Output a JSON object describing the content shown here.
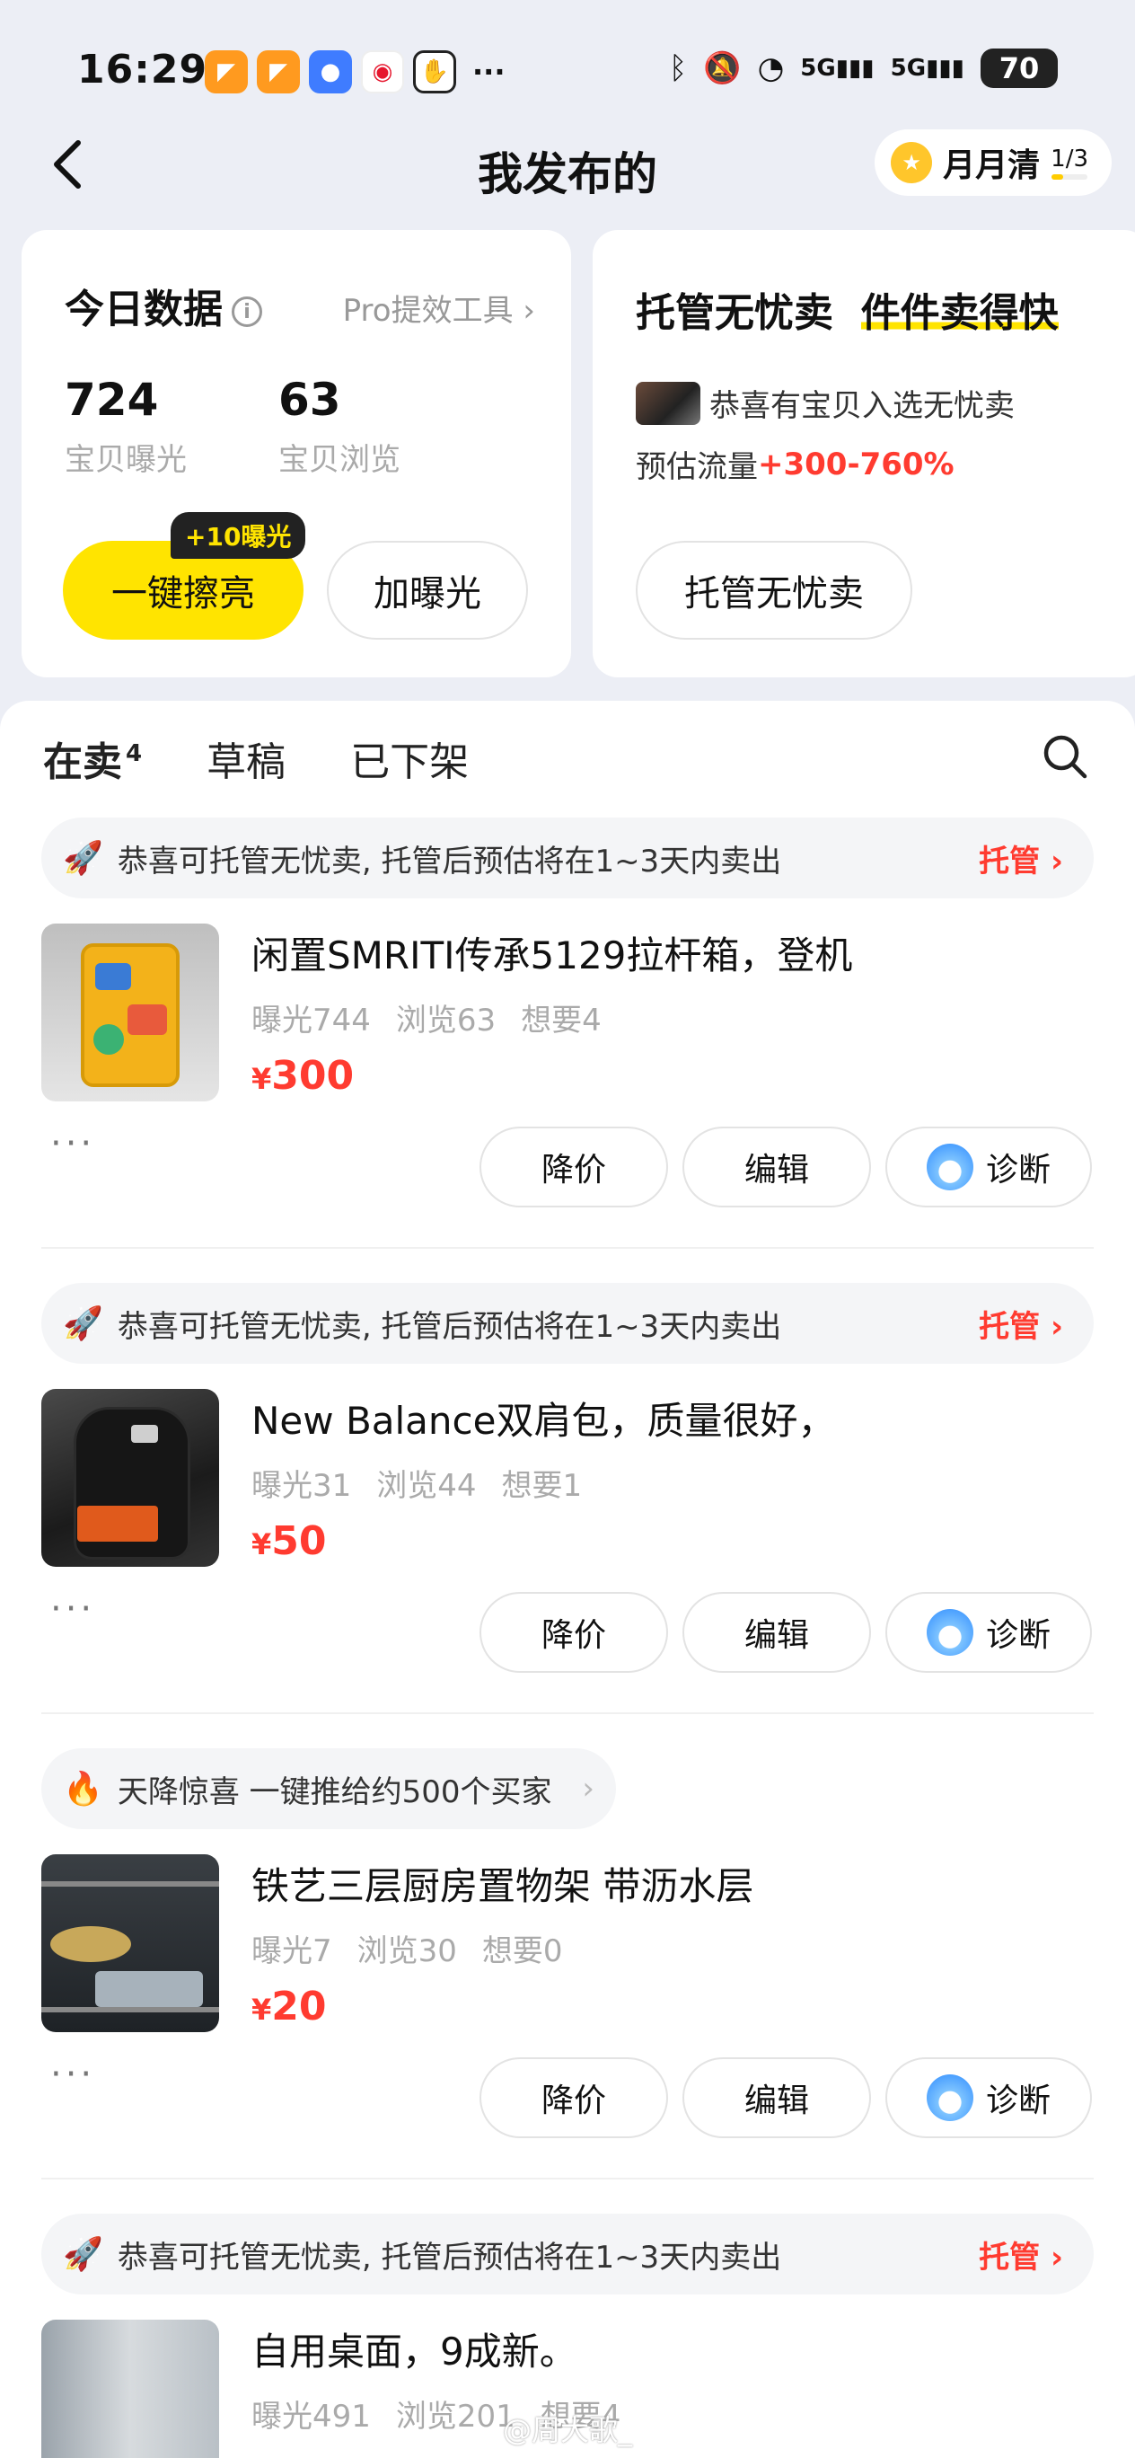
{
  "status_bar": {
    "time": "16:29",
    "more_dots": "···",
    "battery": "70",
    "network": "5G"
  },
  "nav": {
    "back_icon": "‹",
    "title": "我发布的",
    "badge_label": "月月清",
    "badge_progress": "1/3",
    "badge_progress_value": 0.33
  },
  "today": {
    "title": "今日数据",
    "pro_link": "Pro提效工具",
    "exposure_value": "724",
    "exposure_label": "宝贝曝光",
    "views_value": "63",
    "views_label": "宝贝浏览",
    "polish_button": "一键擦亮",
    "polish_bubble": "+10曝光",
    "boost_button": "加曝光"
  },
  "managed": {
    "title_part1": "托管无忧卖",
    "title_part2": "件件卖得快",
    "line1": "恭喜有宝贝入选无忧卖",
    "line2_prefix": "预估流量",
    "line2_value": "+300-760%",
    "button": "托管无忧卖"
  },
  "tabs": {
    "selling": "在卖",
    "selling_count": "4",
    "drafts": "草稿",
    "offline": "已下架"
  },
  "banners": {
    "managed_text": "恭喜可托管无忧卖, 托管后预估将在1~3天内卖出",
    "managed_link": "托管",
    "surprise_text": "天降惊喜 一键推给约500个买家"
  },
  "actions": {
    "reduce": "降价",
    "edit": "编辑",
    "diagnose": "诊断"
  },
  "items": [
    {
      "title": "闲置SMRITI传承5129拉杆箱，登机",
      "exposure": "曝光744",
      "views": "浏览63",
      "wants": "想要4",
      "price": "300"
    },
    {
      "title": "New Balance双肩包，质量很好，",
      "exposure": "曝光31",
      "views": "浏览44",
      "wants": "想要1",
      "price": "50"
    },
    {
      "title": "铁艺三层厨房置物架 带沥水层",
      "exposure": "曝光7",
      "views": "浏览30",
      "wants": "想要0",
      "price": "20"
    },
    {
      "title": "自用桌面，9成新。",
      "exposure": "曝光491",
      "views": "浏览201",
      "wants": "想要4"
    }
  ],
  "currency": "¥",
  "watermark": "@周大歌_",
  "colors": {
    "accent_yellow": "#ffe400",
    "price_red": "#ff3b30"
  }
}
